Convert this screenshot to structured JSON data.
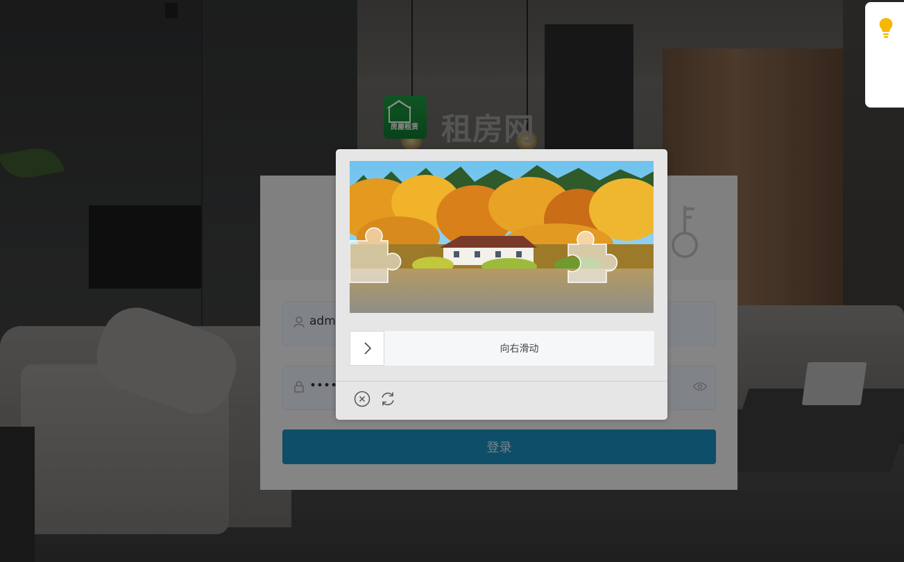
{
  "site": {
    "logo_text": "房屋租赁",
    "name": "租房网"
  },
  "login": {
    "username_value": "admi",
    "password_value": "••••••",
    "submit_label": "登录"
  },
  "captcha": {
    "slider_hint": "向右滑动",
    "close_icon": "close-icon",
    "refresh_icon": "refresh-icon"
  },
  "tip": {
    "icon": "lightbulb-icon",
    "color": "#f5b800"
  },
  "colors": {
    "login_button": "#1d8ebd",
    "logo_green": "#16913b"
  }
}
